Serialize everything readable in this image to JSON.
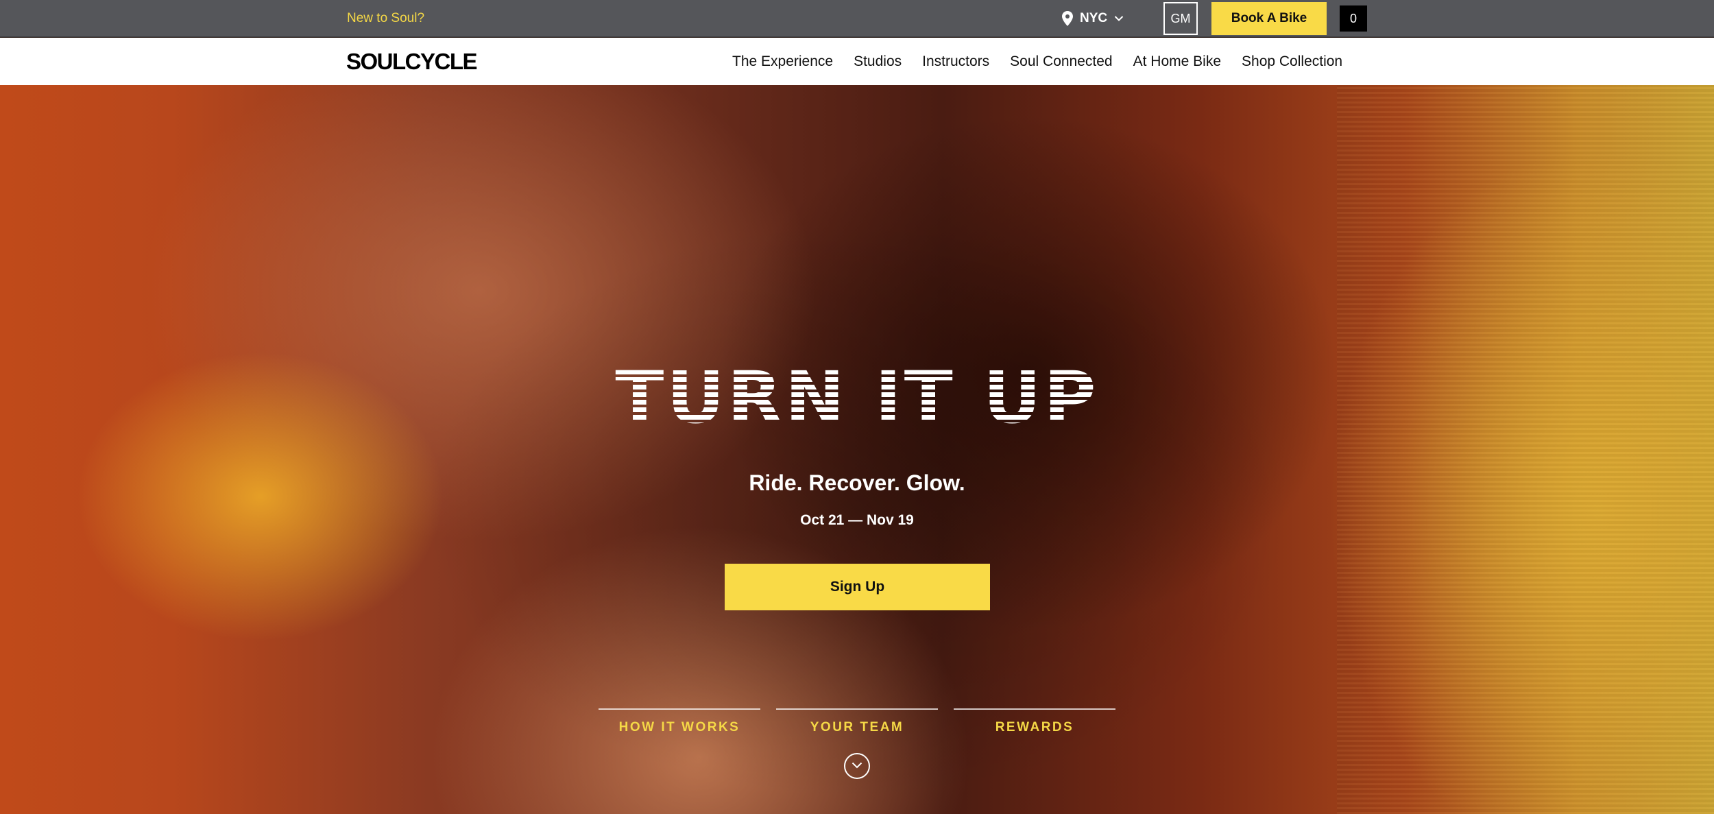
{
  "topbar": {
    "new_to_soul": "New to Soul?",
    "location": "NYC",
    "user_initials": "GM",
    "book_label": "Book A Bike",
    "cart_count": "0"
  },
  "nav": {
    "logo": "SOULCYCLE",
    "links": [
      "The Experience",
      "Studios",
      "Instructors",
      "Soul Connected",
      "At Home Bike",
      "Shop Collection"
    ]
  },
  "hero": {
    "title": "TURN IT UP",
    "subtitle": "Ride. Recover. Glow.",
    "dates": "Oct 21 — Nov 19",
    "cta": "Sign Up",
    "tabs": [
      "HOW IT WORKS",
      "YOUR TEAM",
      "REWARDS"
    ]
  },
  "colors": {
    "accent_yellow": "#f9da47",
    "topbar_gray": "#55565a",
    "link_yellow": "#f5d846"
  },
  "icons": {
    "location": "map-pin-icon",
    "dropdown": "chevron-down-icon",
    "scroll": "chevron-down-circle-icon"
  }
}
